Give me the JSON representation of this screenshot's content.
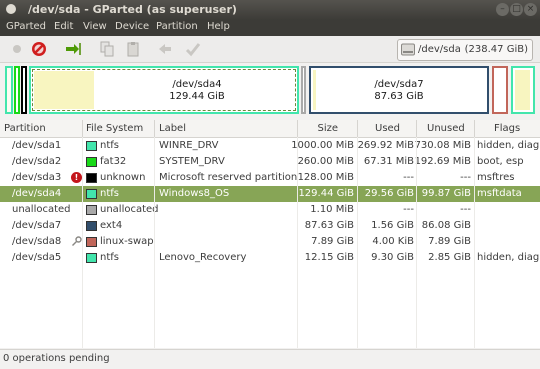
{
  "window": {
    "title": "/dev/sda - GParted (as superuser)"
  },
  "menu": [
    "GParted",
    "Edit",
    "View",
    "Device",
    "Partition",
    "Help"
  ],
  "toolbar": {
    "icons": [
      "new-icon",
      "delete-icon",
      "resize-move-icon",
      "copy-icon",
      "paste-icon",
      "undo-icon",
      "apply-icon"
    ]
  },
  "device": {
    "name": "/dev/sda",
    "size": "(238.47 GiB)"
  },
  "map": {
    "sda4": {
      "name": "/dev/sda4",
      "size": "129.44 GiB",
      "used_fraction": 0.23
    },
    "sda7": {
      "name": "/dev/sda7",
      "size": "87.63 GiB"
    }
  },
  "table": {
    "headers": {
      "partition": "Partition",
      "filesystem": "File System",
      "label": "Label",
      "size": "Size",
      "used": "Used",
      "unused": "Unused",
      "flags": "Flags"
    },
    "rows": [
      {
        "partition": "/dev/sda1",
        "fs": "ntfs",
        "fs_color": "#42e5ac",
        "label": "WINRE_DRV",
        "size": "1000.00 MiB",
        "used": "269.92 MiB",
        "unused": "730.08 MiB",
        "flags": "hidden, diag"
      },
      {
        "partition": "/dev/sda2",
        "fs": "fat32",
        "fs_color": "#18d918",
        "label": "SYSTEM_DRV",
        "size": "260.00 MiB",
        "used": "67.31 MiB",
        "unused": "192.69 MiB",
        "flags": "boot, esp"
      },
      {
        "partition": "/dev/sda3",
        "fs": "unknown",
        "fs_color": "#000000",
        "label": "Microsoft reserved partition",
        "size": "128.00 MiB",
        "used": "---",
        "unused": "---",
        "flags": "msftres",
        "warning": true
      },
      {
        "partition": "/dev/sda4",
        "fs": "ntfs",
        "fs_color": "#42e5ac",
        "label": "Windows8_OS",
        "size": "129.44 GiB",
        "used": "29.56 GiB",
        "unused": "99.87 GiB",
        "flags": "msftdata",
        "selected": true
      },
      {
        "partition": "unallocated",
        "fs": "unallocated",
        "fs_color": "#a9a9a9",
        "label": "",
        "size": "1.10 MiB",
        "used": "---",
        "unused": "---",
        "flags": ""
      },
      {
        "partition": "/dev/sda7",
        "fs": "ext4",
        "fs_color": "#314e6c",
        "label": "",
        "size": "87.63 GiB",
        "used": "1.56 GiB",
        "unused": "86.08 GiB",
        "flags": ""
      },
      {
        "partition": "/dev/sda8",
        "fs": "linux-swap",
        "fs_color": "#c1665a",
        "label": "",
        "size": "7.89 GiB",
        "used": "4.00 KiB",
        "unused": "7.89 GiB",
        "flags": "",
        "key": true
      },
      {
        "partition": "/dev/sda5",
        "fs": "ntfs",
        "fs_color": "#42e5ac",
        "label": "Lenovo_Recovery",
        "size": "12.15 GiB",
        "used": "9.30 GiB",
        "unused": "2.85 GiB",
        "flags": "hidden, diag"
      }
    ]
  },
  "status": {
    "text": "0 operations pending"
  }
}
